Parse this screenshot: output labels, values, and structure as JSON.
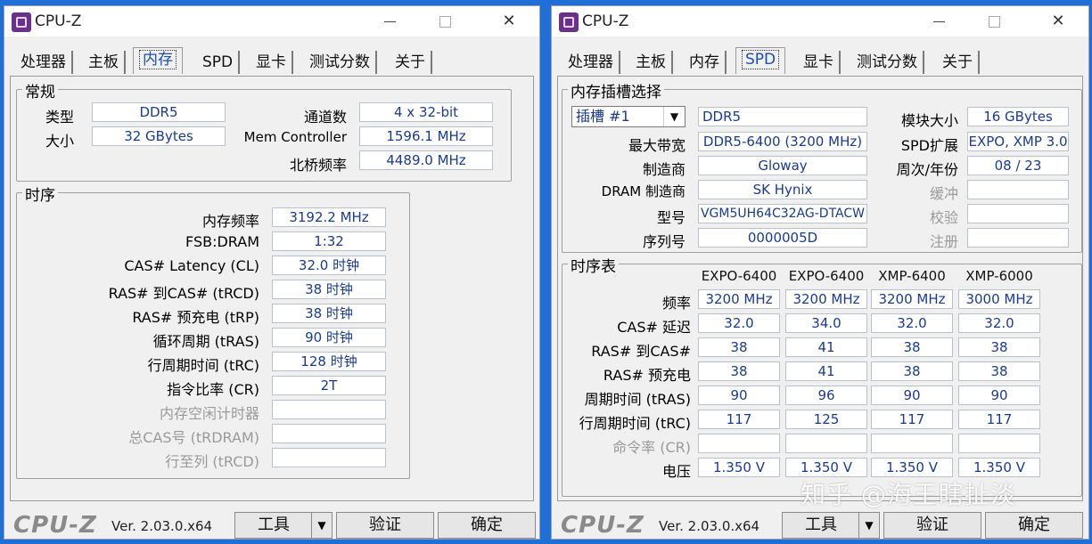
{
  "app": {
    "title": "CPU-Z",
    "version": "Ver. 2.03.0.x64",
    "logo": "CPU-Z"
  },
  "tabs": [
    "处理器",
    "主板",
    "内存",
    "SPD",
    "显卡",
    "测试分数",
    "关于"
  ],
  "buttons": {
    "tools": "工具",
    "validate": "验证",
    "ok": "确定"
  },
  "memory": {
    "general_title": "常规",
    "type_label": "类型",
    "type_value": "DDR5",
    "size_label": "大小",
    "size_value": "32 GBytes",
    "channels_label": "通道数",
    "channels_value": "4 x 32-bit",
    "memctrl_label": "Mem Controller",
    "memctrl_value": "1596.1 MHz",
    "nb_label": "北桥频率",
    "nb_value": "4489.0 MHz",
    "timings_title": "时序",
    "timings": [
      {
        "label": "内存频率",
        "value": "3192.2 MHz",
        "dim": false
      },
      {
        "label": "FSB:DRAM",
        "value": "1:32",
        "dim": false
      },
      {
        "label": "CAS# Latency (CL)",
        "value": "32.0 时钟",
        "dim": false
      },
      {
        "label": "RAS# 到CAS# (tRCD)",
        "value": "38 时钟",
        "dim": false
      },
      {
        "label": "RAS# 预充电 (tRP)",
        "value": "38 时钟",
        "dim": false
      },
      {
        "label": "循环周期 (tRAS)",
        "value": "90 时钟",
        "dim": false
      },
      {
        "label": "行周期时间 (tRC)",
        "value": "128 时钟",
        "dim": false
      },
      {
        "label": "指令比率 (CR)",
        "value": "2T",
        "dim": false
      },
      {
        "label": "内存空闲计时器",
        "value": "",
        "dim": true
      },
      {
        "label": "总CAS号 (tRDRAM)",
        "value": "",
        "dim": true
      },
      {
        "label": "行至列 (tRCD)",
        "value": "",
        "dim": true
      }
    ]
  },
  "spd": {
    "slot_title": "内存插槽选择",
    "slot_select": "插槽 #1",
    "type_value": "DDR5",
    "module_size_label": "模块大小",
    "module_size_value": "16 GBytes",
    "max_bw_label": "最大带宽",
    "max_bw_value": "DDR5-6400 (3200 MHz)",
    "spd_ext_label": "SPD扩展",
    "spd_ext_value": "EXPO, XMP 3.0",
    "maker_label": "制造商",
    "maker_value": "Gloway",
    "week_year_label": "周次/年份",
    "week_year_value": "08 / 23",
    "dram_maker_label": "DRAM 制造商",
    "dram_maker_value": "SK Hynix",
    "buffer_label": "缓冲",
    "part_label": "型号",
    "part_value": "VGM5UH64C32AG-DTACW",
    "check_label": "校验",
    "serial_label": "序列号",
    "serial_value": "0000005D",
    "reg_label": "注册",
    "table_title": "时序表",
    "columns": [
      "EXPO-6400",
      "EXPO-6400",
      "XMP-6400",
      "XMP-6000"
    ],
    "rows": [
      {
        "label": "频率",
        "values": [
          "3200 MHz",
          "3200 MHz",
          "3200 MHz",
          "3000 MHz"
        ],
        "dim": false
      },
      {
        "label": "CAS# 延迟",
        "values": [
          "32.0",
          "34.0",
          "32.0",
          "32.0"
        ],
        "dim": false
      },
      {
        "label": "RAS# 到CAS#",
        "values": [
          "38",
          "41",
          "38",
          "38"
        ],
        "dim": false
      },
      {
        "label": "RAS# 预充电",
        "values": [
          "38",
          "41",
          "38",
          "38"
        ],
        "dim": false
      },
      {
        "label": "周期时间 (tRAS)",
        "values": [
          "90",
          "96",
          "90",
          "90"
        ],
        "dim": false
      },
      {
        "label": "行周期时间 (tRC)",
        "values": [
          "117",
          "125",
          "117",
          "117"
        ],
        "dim": false
      },
      {
        "label": "命令率 (CR)",
        "values": [
          "",
          "",
          "",
          ""
        ],
        "dim": true
      },
      {
        "label": "电压",
        "values": [
          "1.350 V",
          "1.350 V",
          "1.350 V",
          "1.350 V"
        ],
        "dim": false
      }
    ]
  },
  "watermark": "知乎 @海王瞎扯淡",
  "colors": {
    "value_text": "#1a3a9a",
    "active_tab": "#1b4fb8",
    "desktop": "#1f6fd6"
  }
}
